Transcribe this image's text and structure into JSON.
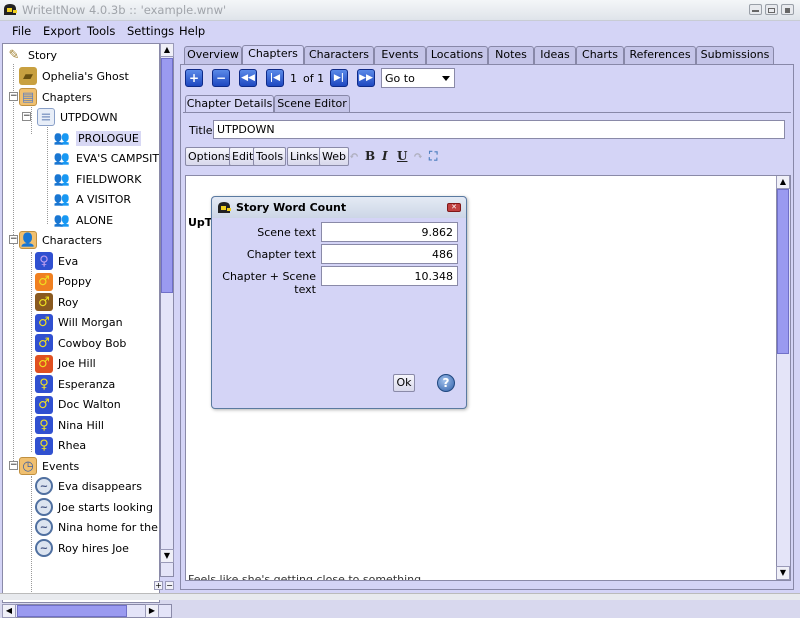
{
  "window": {
    "title": "WriteItNow 4.0.3b :: 'example.wnw'",
    "controls": [
      "minimize",
      "maximize",
      "close"
    ]
  },
  "menubar": {
    "items": [
      "File",
      "Export",
      "Tools",
      "Settings",
      "Help"
    ]
  },
  "tree": {
    "root": "Story",
    "story_title": "Ophelia's Ghost",
    "chapters_label": "Chapters",
    "chapter_group": "UTPDOWN",
    "scenes": [
      "PROLOGUE",
      "EVA'S CAMPSITE",
      "FIELDWORK",
      "A VISITOR",
      "ALONE"
    ],
    "selected_scene": "PROLOGUE",
    "characters_label": "Characters",
    "characters": [
      {
        "name": "Eva",
        "gender": "female",
        "color": "#3050d0"
      },
      {
        "name": "Poppy",
        "gender": "male",
        "color": "#f08020"
      },
      {
        "name": "Roy",
        "gender": "male",
        "color": "#8a5a20"
      },
      {
        "name": "Will Morgan",
        "gender": "male",
        "color": "#3050d0"
      },
      {
        "name": "Cowboy Bob",
        "gender": "male",
        "color": "#3050d0"
      },
      {
        "name": "Joe Hill",
        "gender": "male",
        "color": "#e05020"
      },
      {
        "name": "Esperanza",
        "gender": "female",
        "color": "#3050d0"
      },
      {
        "name": "Doc Walton",
        "gender": "male",
        "color": "#3050d0"
      },
      {
        "name": "Nina Hill",
        "gender": "female",
        "color": "#3050d0"
      },
      {
        "name": "Rhea",
        "gender": "female",
        "color": "#3050d0"
      }
    ],
    "events_label": "Events",
    "events": [
      "Eva disappears",
      "Joe starts looking",
      "Nina home for the weekend",
      "Roy hires Joe"
    ]
  },
  "tabs": {
    "items": [
      "Overview",
      "Chapters",
      "Characters",
      "Events",
      "Locations",
      "Notes",
      "Ideas",
      "Charts",
      "References",
      "Submissions"
    ],
    "active": "Chapters"
  },
  "navigator": {
    "page": "1",
    "of_label": "of 1",
    "goto_label": "Go to"
  },
  "subtabs": {
    "items": [
      "Chapter Details",
      "Scene Editor"
    ],
    "active": "Chapter Details"
  },
  "chapter_details": {
    "title_label": "Title",
    "title_value": "UTPDOWN",
    "toolbar_buttons": [
      "Options",
      "Edit",
      "Tools",
      "Links",
      "Web"
    ],
    "format_icons": [
      "undo",
      "bold",
      "italic",
      "underline",
      "redo",
      "fullscreen"
    ],
    "editor_heading": "UpTo",
    "editor_bottom_text": "Feels like she's getting close to something."
  },
  "dialog": {
    "title": "Story Word Count",
    "rows": [
      {
        "label": "Scene text",
        "value": "9.862"
      },
      {
        "label": "Chapter text",
        "value": "486"
      },
      {
        "label": "Chapter + Scene text",
        "value": "10.348"
      }
    ],
    "ok_label": "Ok",
    "help_label": "?"
  }
}
